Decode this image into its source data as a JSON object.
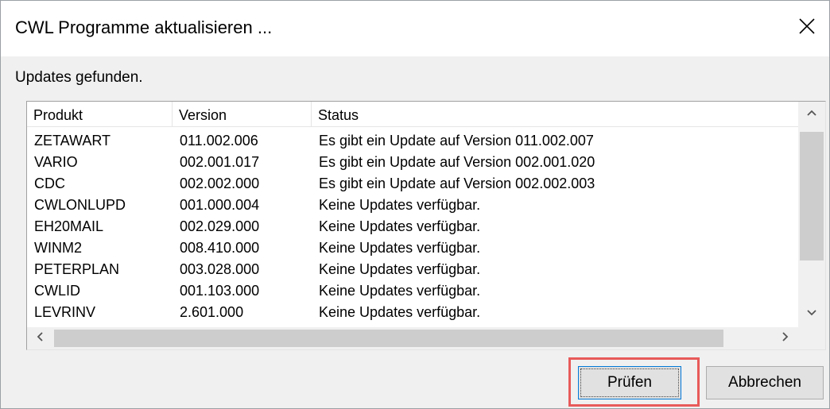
{
  "window": {
    "title": "CWL Programme aktualisieren ...",
    "status_text": "Updates gefunden."
  },
  "table": {
    "columns": [
      "Produkt",
      "Version",
      "Status"
    ],
    "rows": [
      {
        "produkt": "ZETAWART",
        "version": "011.002.006",
        "status": "Es gibt ein Update auf Version 011.002.007"
      },
      {
        "produkt": "VARIO",
        "version": "002.001.017",
        "status": "Es gibt ein Update auf Version 002.001.020"
      },
      {
        "produkt": "CDC",
        "version": "002.002.000",
        "status": "Es gibt ein Update auf Version 002.002.003"
      },
      {
        "produkt": "CWLONLUPD",
        "version": "001.000.004",
        "status": "Keine Updates verfügbar."
      },
      {
        "produkt": "EH20MAIL",
        "version": "002.029.000",
        "status": "Keine Updates verfügbar."
      },
      {
        "produkt": "WINM2",
        "version": "008.410.000",
        "status": "Keine Updates verfügbar."
      },
      {
        "produkt": "PETERPLAN",
        "version": "003.028.000",
        "status": "Keine Updates verfügbar."
      },
      {
        "produkt": "CWLID",
        "version": "001.103.000",
        "status": "Keine Updates verfügbar."
      },
      {
        "produkt": "LEVRINV",
        "version": "2.601.000",
        "status": "Keine Updates verfügbar."
      }
    ]
  },
  "buttons": {
    "pruefen": "Prüfen",
    "abbrechen": "Abbrechen"
  },
  "icons": {
    "close": "close-icon",
    "scroll_up": "chevron-up-icon",
    "scroll_down": "chevron-down-icon",
    "scroll_left": "chevron-left-icon",
    "scroll_right": "chevron-right-icon"
  },
  "colors": {
    "highlight": "#e85a5a",
    "focus_border": "#0078d7"
  }
}
